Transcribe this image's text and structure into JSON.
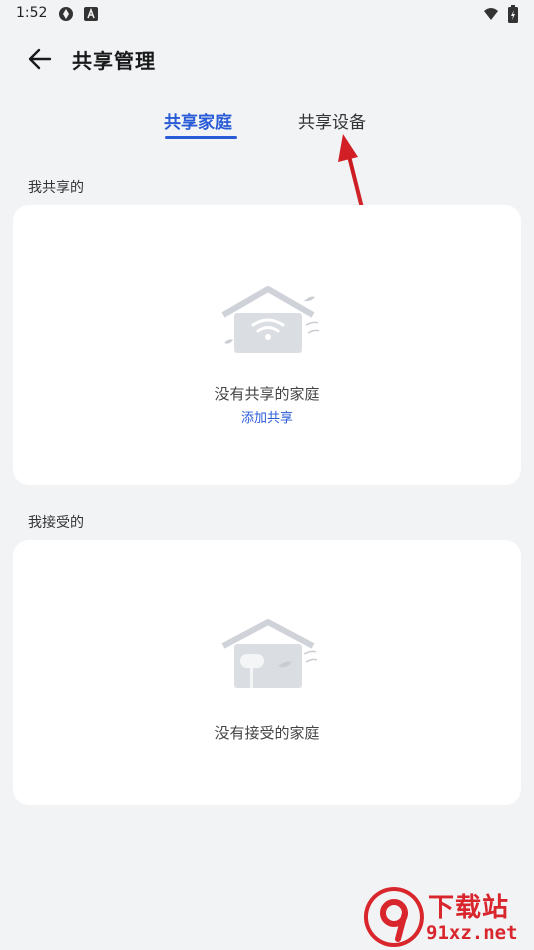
{
  "status_bar": {
    "time": "1:52",
    "icons": [
      "vpn-icon",
      "a-icon",
      "wifi-icon",
      "battery-icon"
    ]
  },
  "header": {
    "title": "共享管理",
    "back_icon": "arrow-left-icon"
  },
  "tabs": [
    {
      "label": "共享家庭",
      "selected": true
    },
    {
      "label": "共享设备",
      "selected": false
    }
  ],
  "sections": {
    "shared": {
      "label": "我共享的",
      "empty_text": "没有共享的家庭",
      "action_label": "添加共享"
    },
    "received": {
      "label": "我接受的",
      "empty_text": "没有接受的家庭"
    }
  },
  "watermark": {
    "logo_text": "9",
    "title": "下载站",
    "url": "91xz.net"
  },
  "colors": {
    "accent": "#2a5bd7",
    "background": "#f1f3f5",
    "card": "#ffffff",
    "annotation_arrow": "#d21e25",
    "watermark": "#d9262c"
  }
}
